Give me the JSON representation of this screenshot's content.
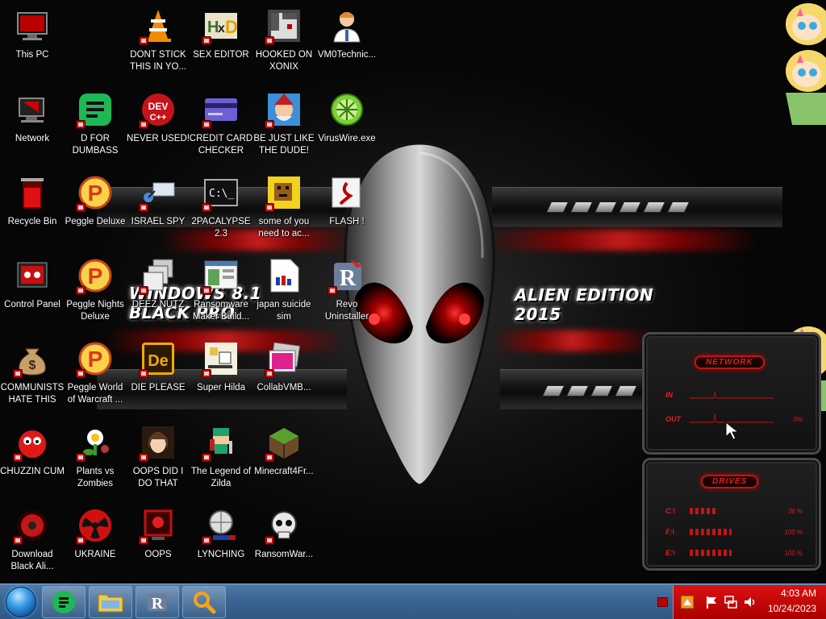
{
  "wallpaper": {
    "title_text": "WINDOWS 8.1 BLACK PRO",
    "edition_text": "ALIEN EDITION 2015"
  },
  "desktop_icons": [
    {
      "label": "This PC",
      "icon": "computer-icon"
    },
    {
      "label": "DONT STICK THIS IN YO...",
      "icon": "vlc-cone-icon"
    },
    {
      "label": "SEX EDITOR",
      "icon": "hxd-editor-icon"
    },
    {
      "label": "HOOKED ON XONIX",
      "icon": "xonix-game-icon"
    },
    {
      "label": "VM0Technic...",
      "icon": "doctor-person-icon"
    },
    {
      "label": "Network",
      "icon": "network-icon"
    },
    {
      "label": "D FOR DUMBASS",
      "icon": "discord-like-green-icon"
    },
    {
      "label": "NEVER USED!",
      "icon": "dev-cpp-icon"
    },
    {
      "label": "CREDIT CARD CHECKER",
      "icon": "credit-card-icon"
    },
    {
      "label": "BE JUST LIKE THE DUDE!",
      "icon": "elf-dude-icon"
    },
    {
      "label": "VirusWire.exe",
      "icon": "limewire-icon"
    },
    {
      "label": "Recycle Bin",
      "icon": "recycle-bin-icon"
    },
    {
      "label": "Peggle Deluxe",
      "icon": "peggle-icon"
    },
    {
      "label": "ISRAEL SPY",
      "icon": "spy-satellite-icon"
    },
    {
      "label": "2PACALYPSE 2.3",
      "icon": "terminal-icon"
    },
    {
      "label": "some of you need to ac...",
      "icon": "pixel-creature-icon"
    },
    {
      "label": "FLASH !",
      "icon": "flash-icon"
    },
    {
      "label": "Control Panel",
      "icon": "control-panel-icon"
    },
    {
      "label": "Peggle Nights Deluxe",
      "icon": "peggle-icon"
    },
    {
      "label": "DEEZ NUTZ",
      "icon": "stacked-windows-icon"
    },
    {
      "label": "Ransomware Maker Build...",
      "icon": "app-window-icon"
    },
    {
      "label": "japan suicide sim",
      "icon": "document-icon"
    },
    {
      "label": "Revo Uninstaller",
      "icon": "revo-uninstaller-icon"
    },
    {
      "label": "COMMUNISTS HATE THIS G...",
      "icon": "money-bag-icon"
    },
    {
      "label": "Peggle World of Warcraft ...",
      "icon": "peggle-icon"
    },
    {
      "label": "DIE PLEASE",
      "icon": "adobe-de-icon"
    },
    {
      "label": "Super Hilda",
      "icon": "pixel-game-icon"
    },
    {
      "label": "CollabVMB...",
      "icon": "photo-stack-icon"
    },
    {
      "label": "CHUZZIN CUM",
      "icon": "chuzzle-icon"
    },
    {
      "label": "Plants vs Zombies",
      "icon": "pvz-flower-icon"
    },
    {
      "label": "OOPS DID I DO THAT",
      "icon": "portrait-painting-icon"
    },
    {
      "label": "The Legend of Zilda",
      "icon": "pixel-hero-icon"
    },
    {
      "label": "Minecraft4Fr...",
      "icon": "minecraft-block-icon"
    },
    {
      "label": "Download Black Ali...",
      "icon": "alien-disc-icon"
    },
    {
      "label": "UKRAINE",
      "icon": "radiation-icon"
    },
    {
      "label": "OOPS",
      "icon": "red-monitor-icon"
    },
    {
      "label": "LYNCHING",
      "icon": "network-globe-icon"
    },
    {
      "label": "RansomWar...",
      "icon": "skull-icon"
    }
  ],
  "gadgets": {
    "network": {
      "title": "NETWORK",
      "in_label": "IN",
      "out_label": "OUT",
      "out_value": "0%"
    },
    "drives": {
      "title": "DRIVES",
      "rows": [
        {
          "drive": "C:\\",
          "value": "36 %",
          "fill": 0.36
        },
        {
          "drive": "F:\\",
          "value": "100 %",
          "fill": 1.0
        },
        {
          "drive": "E:\\",
          "value": "100 %",
          "fill": 1.0
        }
      ]
    }
  },
  "taskbar": {
    "pinned": [
      {
        "name": "discord-like-green-icon"
      },
      {
        "name": "file-explorer-icon"
      },
      {
        "name": "revo-uninstaller-icon"
      },
      {
        "name": "search-magnifier-icon"
      }
    ],
    "tray": {
      "time": "4:03 AM",
      "date": "10/24/2023"
    }
  },
  "colors": {
    "accent_red": "#d01515",
    "taskbar_blue": "#3a6592",
    "tray_red": "#c00000"
  }
}
